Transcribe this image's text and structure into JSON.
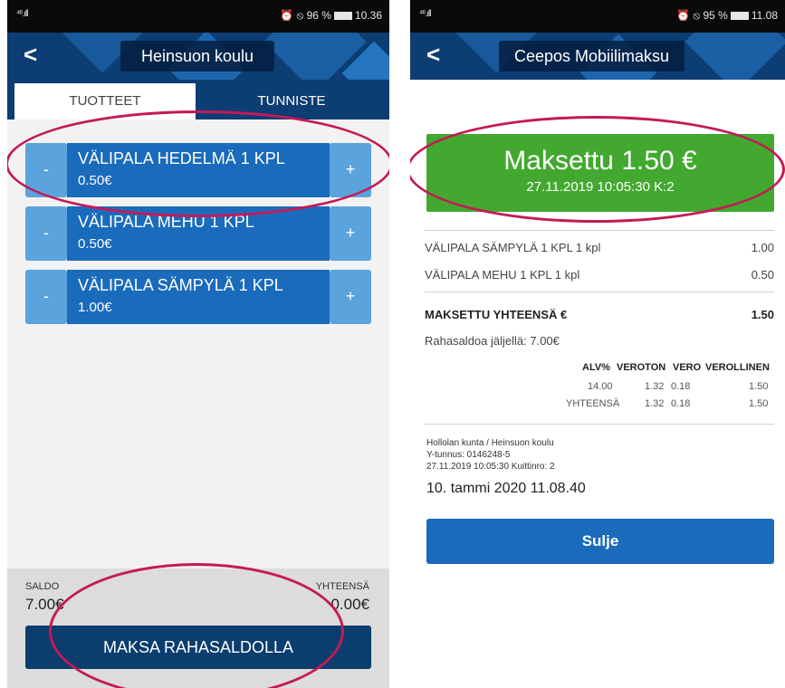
{
  "left_screen": {
    "status": {
      "signal": "⁴⁶.ıll",
      "right": "⏰ ⦸ 96 %",
      "time": "10.36"
    },
    "header": {
      "back": "<",
      "title": "Heinsuon koulu"
    },
    "tabs": [
      {
        "label": "TUOTTEET"
      },
      {
        "label": "TUNNISTE"
      }
    ],
    "products": [
      {
        "name": "VÄLIPALA HEDELMÄ 1 KPL",
        "price": "0.50€",
        "minus": "-",
        "plus": "+"
      },
      {
        "name": "VÄLIPALA MEHU 1 KPL",
        "price": "0.50€",
        "minus": "-",
        "plus": "+"
      },
      {
        "name": "VÄLIPALA SÄMPYLÄ 1 KPL",
        "price": "1.00€",
        "minus": "-",
        "plus": "+"
      }
    ],
    "footer": {
      "saldo_label": "SALDO",
      "saldo_value": "7.00€",
      "total_label": "YHTEENSÄ",
      "total_value": "0.00€",
      "pay_button": "MAKSA RAHASALDOLLA"
    }
  },
  "right_screen": {
    "status": {
      "signal": "⁴⁶.ıll",
      "right": "⏰ ⦸ 95 %",
      "time": "11.08"
    },
    "header": {
      "back": "<",
      "title": "Ceepos Mobiilimaksu"
    },
    "paid": {
      "amount": "Maksettu 1.50 €",
      "meta": "27.11.2019 10:05:30 K:2"
    },
    "lines": [
      {
        "item": "VÄLIPALA SÄMPYLÄ 1 KPL 1 kpl",
        "amount": "1.00"
      },
      {
        "item": "VÄLIPALA MEHU 1 KPL 1 kpl",
        "amount": "0.50"
      }
    ],
    "total": {
      "label": "MAKSETTU YHTEENSÄ €",
      "amount": "1.50"
    },
    "balance": "Rahasaldoa jäljellä: 7.00€",
    "vat": {
      "headers": [
        "ALV%",
        "VEROTON",
        "VERO",
        "VEROLLINEN"
      ],
      "rows": [
        {
          "label": "",
          "alv": "14.00",
          "veroton": "1.32",
          "vero": "0.18",
          "verollinen": "1.50"
        },
        {
          "label": "YHTEENSÄ",
          "alv": "",
          "veroton": "1.32",
          "vero": "0.18",
          "verollinen": "1.50"
        }
      ]
    },
    "merchant": {
      "line1": "Hollolan kunta / Heinsuon koulu",
      "line2": "Y-tunnus: 0146248-5",
      "line3": "27.11.2019 10:05:30 Kuittinro: 2"
    },
    "timestamp": "10. tammi 2020 11.08.40",
    "close_button": "Sulje"
  },
  "colors": {
    "header_blue": "#0c3d73",
    "product_blue": "#1a6bbb",
    "product_button": "#5aa3dd",
    "paid_green": "#43a82f",
    "pay_button": "#0b3d6e",
    "annotation": "#c41a57"
  }
}
